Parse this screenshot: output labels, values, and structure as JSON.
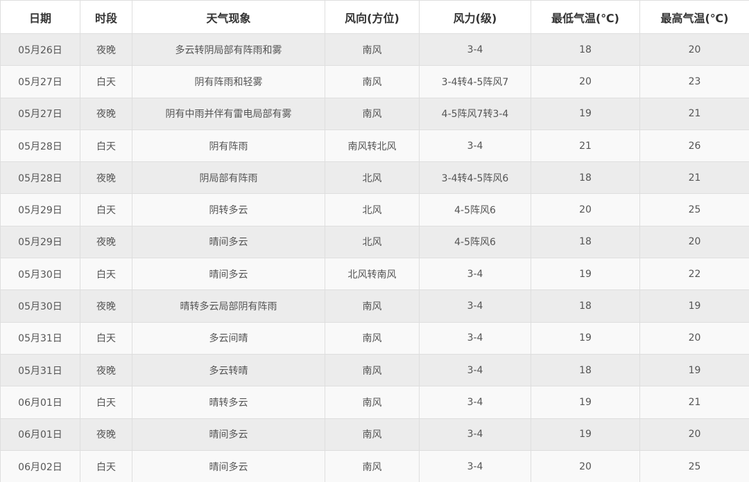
{
  "table": {
    "headers": [
      "日期",
      "时段",
      "天气现象",
      "风向(方位)",
      "风力(级)",
      "最低气温(℃)",
      "最高气温(℃)"
    ],
    "rows": [
      [
        "05月26日",
        "夜晚",
        "多云转阴局部有阵雨和雾",
        "南风",
        "3-4",
        "18",
        "20"
      ],
      [
        "05月27日",
        "白天",
        "阴有阵雨和轻雾",
        "南风",
        "3-4转4-5阵风7",
        "20",
        "23"
      ],
      [
        "05月27日",
        "夜晚",
        "阴有中雨并伴有雷电局部有雾",
        "南风",
        "4-5阵风7转3-4",
        "19",
        "21"
      ],
      [
        "05月28日",
        "白天",
        "阴有阵雨",
        "南风转北风",
        "3-4",
        "21",
        "26"
      ],
      [
        "05月28日",
        "夜晚",
        "阴局部有阵雨",
        "北风",
        "3-4转4-5阵风6",
        "18",
        "21"
      ],
      [
        "05月29日",
        "白天",
        "阴转多云",
        "北风",
        "4-5阵风6",
        "20",
        "25"
      ],
      [
        "05月29日",
        "夜晚",
        "晴间多云",
        "北风",
        "4-5阵风6",
        "18",
        "20"
      ],
      [
        "05月30日",
        "白天",
        "晴间多云",
        "北风转南风",
        "3-4",
        "19",
        "22"
      ],
      [
        "05月30日",
        "夜晚",
        "晴转多云局部阴有阵雨",
        "南风",
        "3-4",
        "18",
        "19"
      ],
      [
        "05月31日",
        "白天",
        "多云间晴",
        "南风",
        "3-4",
        "19",
        "20"
      ],
      [
        "05月31日",
        "夜晚",
        "多云转晴",
        "南风",
        "3-4",
        "18",
        "19"
      ],
      [
        "06月01日",
        "白天",
        "晴转多云",
        "南风",
        "3-4",
        "19",
        "21"
      ],
      [
        "06月01日",
        "夜晚",
        "晴间多云",
        "南风",
        "3-4",
        "19",
        "20"
      ],
      [
        "06月02日",
        "白天",
        "晴间多云",
        "南风",
        "3-4",
        "20",
        "25"
      ]
    ]
  },
  "colors": {
    "row_odd": "#ececec",
    "row_even": "#f9f9f9",
    "border": "#dedede",
    "header_text": "#333333",
    "cell_text": "#555555"
  }
}
